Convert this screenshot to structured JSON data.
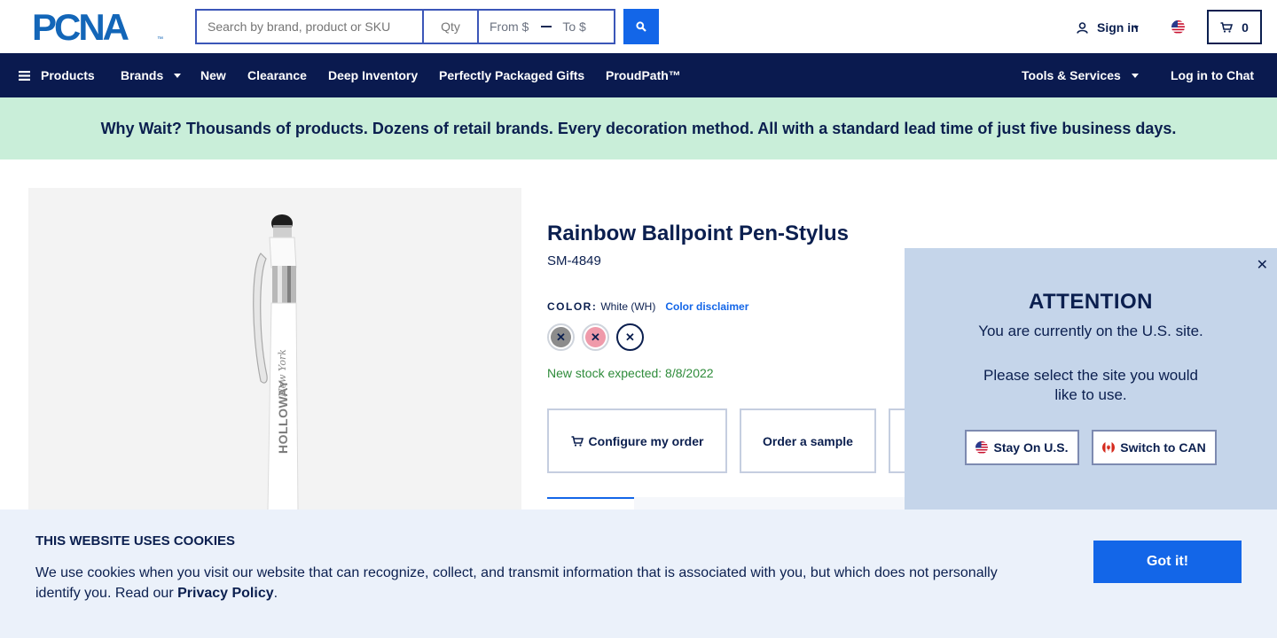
{
  "header": {
    "logo_text": "PCNA",
    "logo_tm": "™",
    "search_placeholder": "Search by brand, product or SKU",
    "qty_placeholder": "Qty",
    "price_from": "From $",
    "price_to": "To $",
    "sign_in": "Sign in",
    "cart_count": "0"
  },
  "nav": {
    "products": "Products",
    "brands": "Brands",
    "new": "New",
    "clearance": "Clearance",
    "deep_inventory": "Deep Inventory",
    "gifts": "Perfectly Packaged Gifts",
    "proudpath": "ProudPath™",
    "tools": "Tools & Services",
    "chat": "Log in to Chat"
  },
  "promo": {
    "text": "Why Wait? Thousands of products. Dozens of retail brands. Every decoration method. All with a standard lead time of just five business days."
  },
  "product": {
    "title": "Rainbow Ballpoint Pen-Stylus",
    "sku": "SM-4849",
    "color_label": "COLOR:",
    "color_value": "White (WH)",
    "color_disclaimer": "Color disclaimer",
    "stock_message": "New stock expected: 8/8/2022",
    "image_imprint": "HOLLOWAY",
    "image_imprint_script": "New York",
    "swatches": [
      {
        "color": "#8c8c8c",
        "state": "x"
      },
      {
        "color": "#ef9aaa",
        "state": "x"
      },
      {
        "color": "#ffffff",
        "state": "x"
      }
    ],
    "configure_btn": "Configure my order",
    "sample_btn": "Order a sample"
  },
  "attention": {
    "heading": "ATTENTION",
    "line1": "You are currently on the U.S. site.",
    "line2": "Please select the site you would like to use.",
    "stay_btn": "Stay On U.S.",
    "switch_btn": "Switch to CAN"
  },
  "cookie": {
    "heading": "THIS WEBSITE USES COOKIES",
    "body": "We use cookies when you visit our website that can recognize, collect, and transmit information that is associated with you, but which does not personally identify you. Read our ",
    "link": "Privacy Policy",
    "end": ".",
    "button": "Got it!"
  },
  "colors": {
    "navy": "#0a1a4f",
    "accent_blue": "#1366e8",
    "promo_bg": "#c9eed9",
    "stock_green": "#2e8b3a",
    "attention_bg": "#c5d5ea",
    "cookie_bg": "#ebf1fa"
  }
}
